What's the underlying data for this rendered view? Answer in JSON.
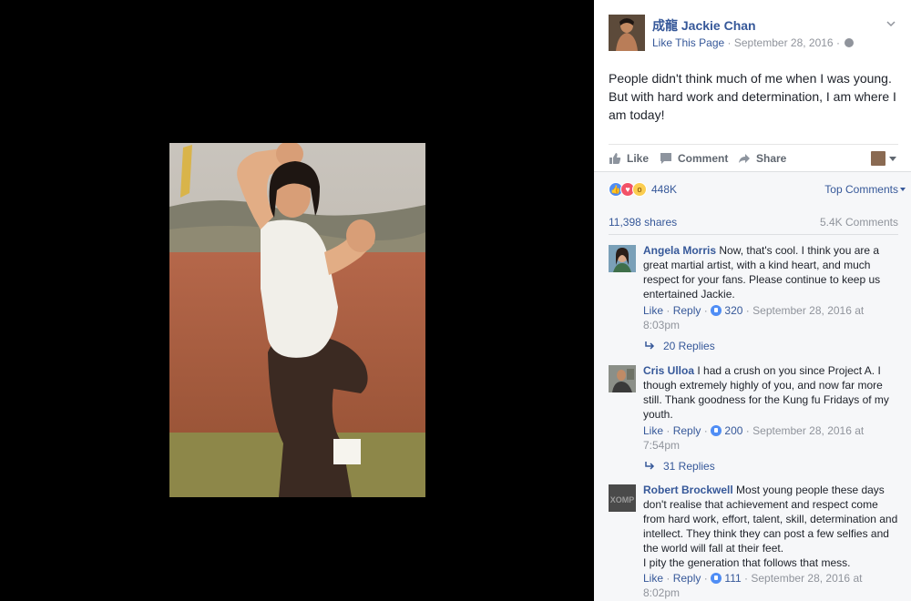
{
  "post": {
    "page_name": "成龍 Jackie Chan",
    "like_page": "Like This Page",
    "separator": "·",
    "date": "September 28, 2016",
    "privacy_separator": "·",
    "text": "People didn't think much of me when I was young. But with hard work and determination, I am where I am today!"
  },
  "actions": {
    "like": "Like",
    "comment": "Comment",
    "share": "Share"
  },
  "feedback": {
    "reaction_count": "448K",
    "sort_label": "Top Comments",
    "shares": "11,398 shares",
    "comments": "5.4K Comments"
  },
  "comments": [
    {
      "name": "Angela Morris",
      "text": " Now, that's cool. I think you are a great martial artist, with a kind heart, and much respect for your fans. Please continue to keep us entertained Jackie.",
      "like": "Like",
      "reply": "Reply",
      "sep1": "·",
      "sep2": "·",
      "likes": "320",
      "time": "September 28, 2016 at 8:03pm",
      "replies": "20 Replies"
    },
    {
      "name": "Cris Ulloa",
      "text": " I had a crush on you since Project A. I though extremely highly of you, and now far more still. Thank goodness for the Kung fu Fridays of my youth.",
      "like": "Like",
      "reply": "Reply",
      "sep1": "·",
      "sep2": "·",
      "likes": "200",
      "time": "September 28, 2016 at 7:54pm",
      "replies": "31 Replies"
    },
    {
      "name": "Robert Brockwell",
      "text": " Most young people these days don't realise that achievement and respect come from hard work, effort, talent, skill, determination and intellect. They think they can post a few selfies and the world will fall at their feet.",
      "text2": "I pity the generation that follows that mess.",
      "avatar_text": "XOMP",
      "like": "Like",
      "reply": "Reply",
      "sep1": "·",
      "sep2": "·",
      "likes": "111",
      "time": "September 28, 2016 at 8:02pm"
    }
  ],
  "colors": {
    "link": "#365899",
    "meta": "#90949c",
    "feedback_bg": "#f6f7f9",
    "like_blue": "#4f8df5",
    "love_red": "#f25268",
    "wow_yellow": "#fbcd50"
  }
}
